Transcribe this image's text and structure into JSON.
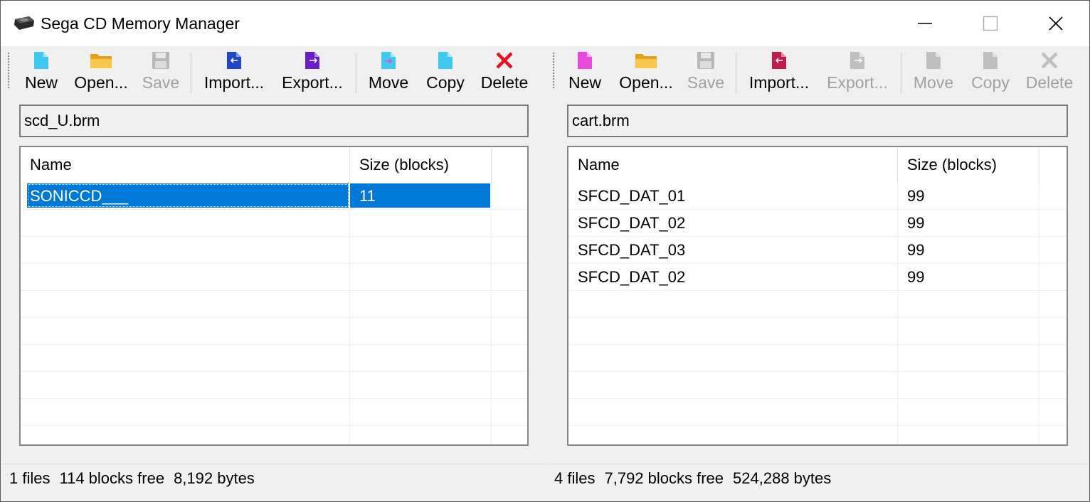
{
  "window": {
    "title": "Sega CD Memory Manager"
  },
  "left": {
    "toolbar": {
      "new": "New",
      "open": "Open...",
      "save": "Save",
      "import": "Import...",
      "export": "Export...",
      "move": "Move",
      "copy": "Copy",
      "delete": "Delete"
    },
    "path": "scd_U.brm",
    "columns": {
      "name": "Name",
      "size": "Size (blocks)"
    },
    "rows": [
      {
        "name": "SONICCD___",
        "size": "11"
      }
    ],
    "status": {
      "files": "1 files",
      "free": "114 blocks free",
      "bytes": "8,192 bytes"
    },
    "colors": {
      "new": "#3fc8f0",
      "import": "#1e48c8",
      "export": "#6a1ec8",
      "move": "#3fc8f0",
      "copy": "#3fc8f0",
      "delete": "#e81123"
    }
  },
  "right": {
    "toolbar": {
      "new": "New",
      "open": "Open...",
      "save": "Save",
      "import": "Import...",
      "export": "Export...",
      "move": "Move",
      "copy": "Copy",
      "delete": "Delete"
    },
    "path": "cart.brm",
    "columns": {
      "name": "Name",
      "size": "Size (blocks)"
    },
    "rows": [
      {
        "name": "SFCD_DAT_01",
        "size": "99"
      },
      {
        "name": "SFCD_DAT_02",
        "size": "99"
      },
      {
        "name": "SFCD_DAT_03",
        "size": "99"
      },
      {
        "name": "SFCD_DAT_02",
        "size": "99"
      }
    ],
    "status": {
      "files": "4 files",
      "free": "7,792 blocks free",
      "bytes": "524,288 bytes"
    },
    "colors": {
      "new": "#e64ad8",
      "import": "#c01c4e"
    }
  },
  "selection_color": "#0078d7"
}
